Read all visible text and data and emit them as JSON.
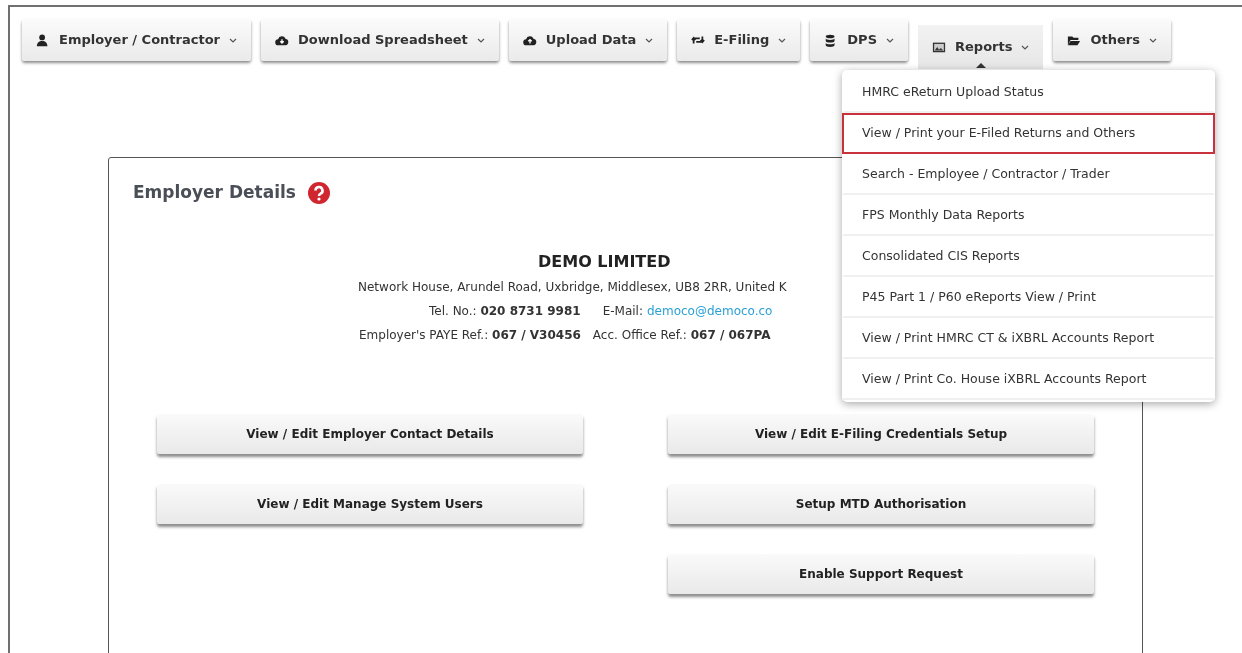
{
  "nav": [
    {
      "label": "Employer / Contractor",
      "selected": false
    },
    {
      "label": "Download Spreadsheet",
      "selected": false
    },
    {
      "label": "Upload Data",
      "selected": false
    },
    {
      "label": "E-Filing",
      "selected": false
    },
    {
      "label": "DPS",
      "selected": false
    },
    {
      "label": "Reports",
      "selected": true
    },
    {
      "label": "Others",
      "selected": false
    }
  ],
  "reports_menu": [
    {
      "label": "HMRC eReturn Upload Status",
      "selected": false
    },
    {
      "label": "View / Print your E-Filed Returns and Others",
      "selected": true
    },
    {
      "label": "Search - Employee / Contractor / Trader",
      "selected": false
    },
    {
      "label": "FPS Monthly Data Reports",
      "selected": false
    },
    {
      "label": "Consolidated CIS Reports",
      "selected": false
    },
    {
      "label": "P45 Part 1 / P60 eReports View / Print",
      "selected": false
    },
    {
      "label": "View / Print HMRC CT & iXBRL Accounts Report",
      "selected": false
    },
    {
      "label": "View / Print Co. House iXBRL Accounts Report",
      "selected": false
    }
  ],
  "employer": {
    "title": "Employer Details",
    "company": "DEMO LIMITED",
    "address": "Network House, Arundel Road, Uxbridge, Middlesex, UB8 2RR, United K",
    "tel_label": "Tel. No.:",
    "tel": "020 8731 9981",
    "email_label": "E-Mail:",
    "email": "democo@democo.co",
    "paye_label": "Employer's PAYE Ref.:",
    "paye": "067 / V30456",
    "office_label": "Acc. Office Ref.:",
    "office": "067 / 067PA"
  },
  "actions_left": [
    "View / Edit Employer Contact Details",
    "View / Edit Manage System Users"
  ],
  "actions_right": [
    "View / Edit E-Filing Credentials Setup",
    "Setup MTD Authorisation",
    "Enable Support Request"
  ]
}
